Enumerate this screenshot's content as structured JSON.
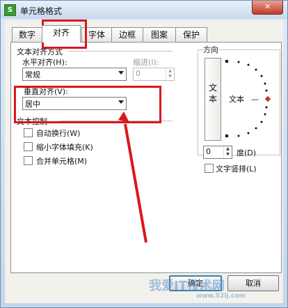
{
  "window": {
    "title": "单元格格式",
    "app_icon": "S",
    "close_glyph": "✕"
  },
  "tabs": [
    {
      "label": "数字",
      "active": false
    },
    {
      "label": "对齐",
      "active": true
    },
    {
      "label": "字体",
      "active": false
    },
    {
      "label": "边框",
      "active": false
    },
    {
      "label": "图案",
      "active": false
    },
    {
      "label": "保护",
      "active": false
    }
  ],
  "alignment": {
    "group_label": "文本对齐方式",
    "horizontal_label": "水平对齐(H):",
    "horizontal_value": "常规",
    "indent_label": "缩进(I):",
    "indent_value": "0",
    "vertical_label": "垂直对齐(V):",
    "vertical_value": "居中"
  },
  "text_control": {
    "group_label": "文本控制",
    "wrap_label": "自动换行(W)",
    "wrap_checked": false,
    "shrink_label": "缩小字体填充(K)",
    "shrink_checked": false,
    "merge_label": "合并单元格(M)",
    "merge_checked": false
  },
  "orientation": {
    "group_label": "方向",
    "vertical_text_button": "文本",
    "dial_text": "文本",
    "dial_line": "—",
    "degree_value": "0",
    "degree_label": "度(D)",
    "stack_label": "文字竖排(L)",
    "stack_checked": false
  },
  "buttons": {
    "ok": "确定",
    "cancel": "取消"
  },
  "watermark": {
    "text": "我爱IT技术网",
    "url": "www.52ij.com"
  },
  "colors": {
    "highlight_red": "#d8181d",
    "frame_blue": "#c9d9ec"
  }
}
